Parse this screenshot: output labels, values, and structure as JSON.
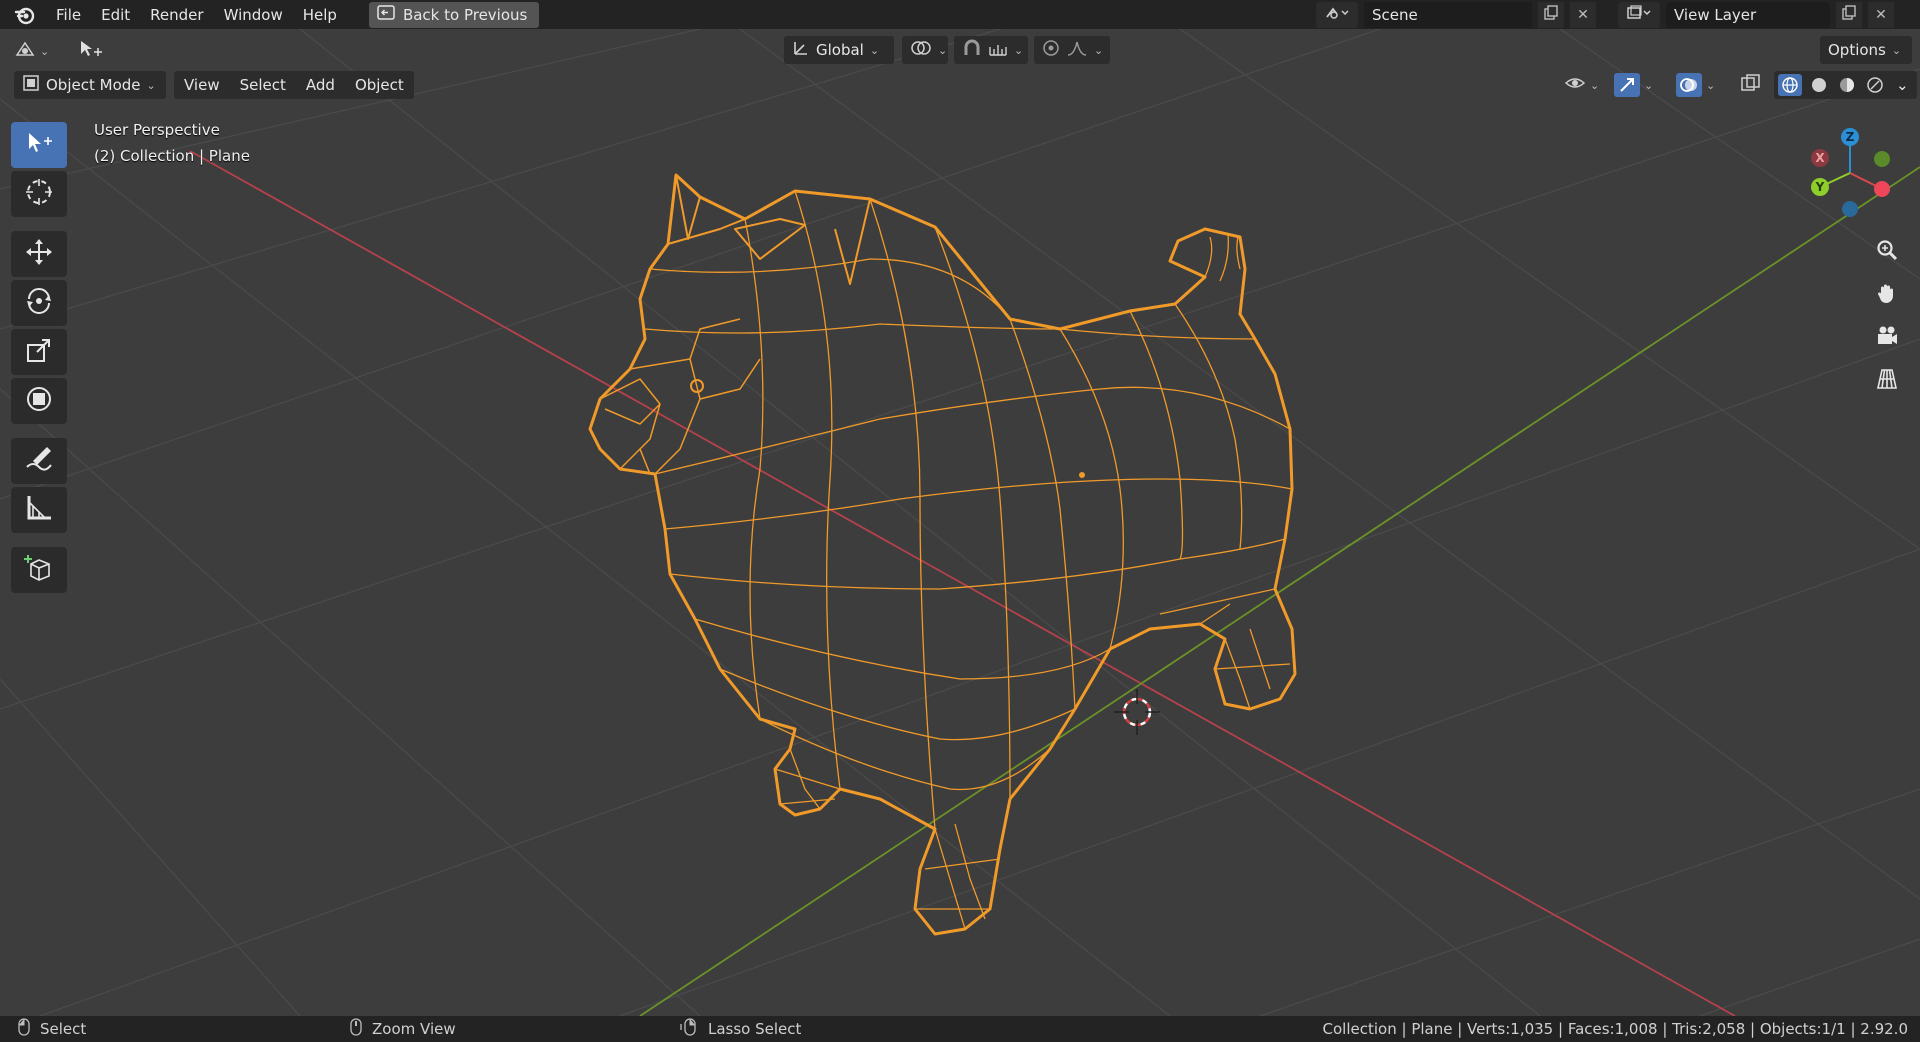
{
  "menubar": {
    "items": [
      "File",
      "Edit",
      "Render",
      "Window",
      "Help"
    ],
    "back_button": "Back to Previous",
    "scene": "Scene",
    "view_layer": "View Layer"
  },
  "header": {
    "transform_orientation": "Global",
    "options": "Options",
    "mode": "Object Mode",
    "menus": [
      "View",
      "Select",
      "Add",
      "Object"
    ]
  },
  "viewport": {
    "perspective": "User Perspective",
    "collection": "(2) Collection | Plane",
    "gizmo_axes": [
      "X",
      "Y",
      "Z"
    ]
  },
  "toolbar": {
    "tools": [
      "select-box",
      "cursor",
      "move",
      "rotate",
      "scale",
      "transform",
      "annotate",
      "measure",
      "add-cube"
    ],
    "active": "select-box"
  },
  "statusbar": {
    "select": "Select",
    "zoom": "Zoom View",
    "lasso": "Lasso Select",
    "stats": "Collection | Plane | Verts:1,035 | Faces:1,008 | Tris:2,058 | Objects:1/1 | 2.92.0"
  },
  "colors": {
    "accent": "#4772b3",
    "selection": "#f09a2a",
    "axis_x": "#d14a4e",
    "axis_y": "#6a9e2a",
    "axis_z": "#2c8fd6",
    "grid": "#4c4c4c"
  }
}
